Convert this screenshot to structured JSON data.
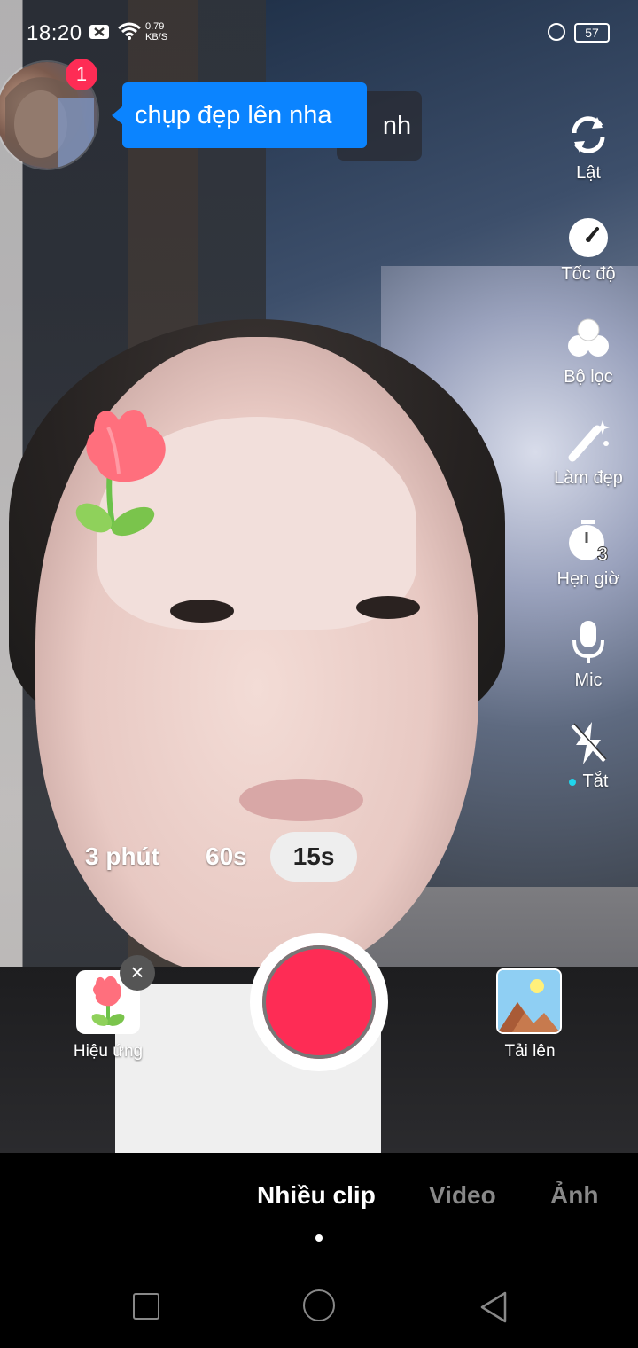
{
  "status_bar": {
    "time": "18:20",
    "net_speed_value": "0.79",
    "net_speed_unit": "KB/S",
    "battery": "57"
  },
  "profile": {
    "notification_count": "1",
    "tooltip_text": "chụp đẹp lên nha",
    "behind_tooltip_text": "nh"
  },
  "side_tools": [
    {
      "label": "Lật",
      "icon": "flip-camera-icon"
    },
    {
      "label": "Tốc độ",
      "icon": "speed-icon"
    },
    {
      "label": "Bộ lọc",
      "icon": "filter-icon"
    },
    {
      "label": "Làm đẹp",
      "icon": "beauty-wand-icon"
    },
    {
      "label": "Hẹn giờ",
      "icon": "timer-icon",
      "badge": "3"
    },
    {
      "label": "Mic",
      "icon": "microphone-icon"
    },
    {
      "label": "Tắt",
      "icon": "flash-off-icon"
    }
  ],
  "durations": {
    "options": [
      "3 phút",
      "60s",
      "15s"
    ],
    "selected": "15s"
  },
  "effects": {
    "label": "Hiệu ứng",
    "close_glyph": "×"
  },
  "upload": {
    "label": "Tải lên"
  },
  "modes": {
    "tabs": [
      "Nhiều clip",
      "Video",
      "Ảnh"
    ],
    "active": "Nhiều clip"
  },
  "colors": {
    "record": "#fe2c55",
    "tooltip": "#0b84ff",
    "badge": "#fe2c55",
    "indicator": "#20d5ec"
  }
}
